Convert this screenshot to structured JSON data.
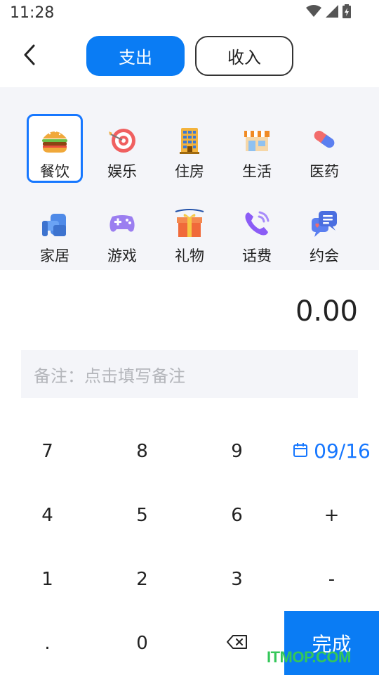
{
  "status_bar": {
    "time": "11:28"
  },
  "header": {
    "tab_expense": "支出",
    "tab_income": "收入"
  },
  "categories": [
    {
      "label": "餐饮",
      "icon": "burger-icon"
    },
    {
      "label": "娱乐",
      "icon": "dart-target-icon"
    },
    {
      "label": "住房",
      "icon": "building-icon"
    },
    {
      "label": "生活",
      "icon": "shop-icon"
    },
    {
      "label": "医药",
      "icon": "pill-icon"
    },
    {
      "label": "家居",
      "icon": "sofa-icon"
    },
    {
      "label": "游戏",
      "icon": "gamepad-icon"
    },
    {
      "label": "礼物",
      "icon": "gift-icon"
    },
    {
      "label": "话费",
      "icon": "phone-icon"
    },
    {
      "label": "约会",
      "icon": "chat-heart-icon"
    }
  ],
  "selected_category": "餐饮",
  "amount": "0.00",
  "note": {
    "placeholder": "备注：点击填写备注"
  },
  "keypad": {
    "k7": "7",
    "k8": "8",
    "k9": "9",
    "date": "09/16",
    "k4": "4",
    "k5": "5",
    "k6": "6",
    "plus": "+",
    "k1": "1",
    "k2": "2",
    "k3": "3",
    "minus": "-",
    "dot": ".",
    "k0": "0",
    "done": "完成"
  },
  "watermark": "ITMOP.COM",
  "colors": {
    "accent": "#0a7cf4",
    "panel": "#f4f5f9",
    "date": "#1677ff",
    "watermark": "#34c759"
  }
}
